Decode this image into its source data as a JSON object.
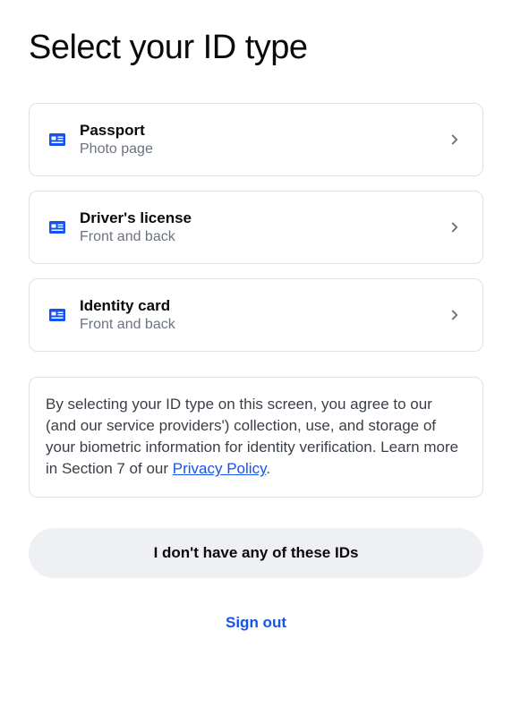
{
  "title": "Select your ID type",
  "options": [
    {
      "title": "Passport",
      "subtitle": "Photo page"
    },
    {
      "title": "Driver's license",
      "subtitle": "Front and back"
    },
    {
      "title": "Identity card",
      "subtitle": "Front and back"
    }
  ],
  "disclaimer": {
    "text_before": "By selecting your ID type on this screen, you agree to our (and our service providers') collection, use, and storage of your biometric information for identity verification. Learn more in Section 7 of our ",
    "link_text": "Privacy Policy",
    "text_after": "."
  },
  "none_button": "I don't have any of these IDs",
  "signout_button": "Sign out"
}
